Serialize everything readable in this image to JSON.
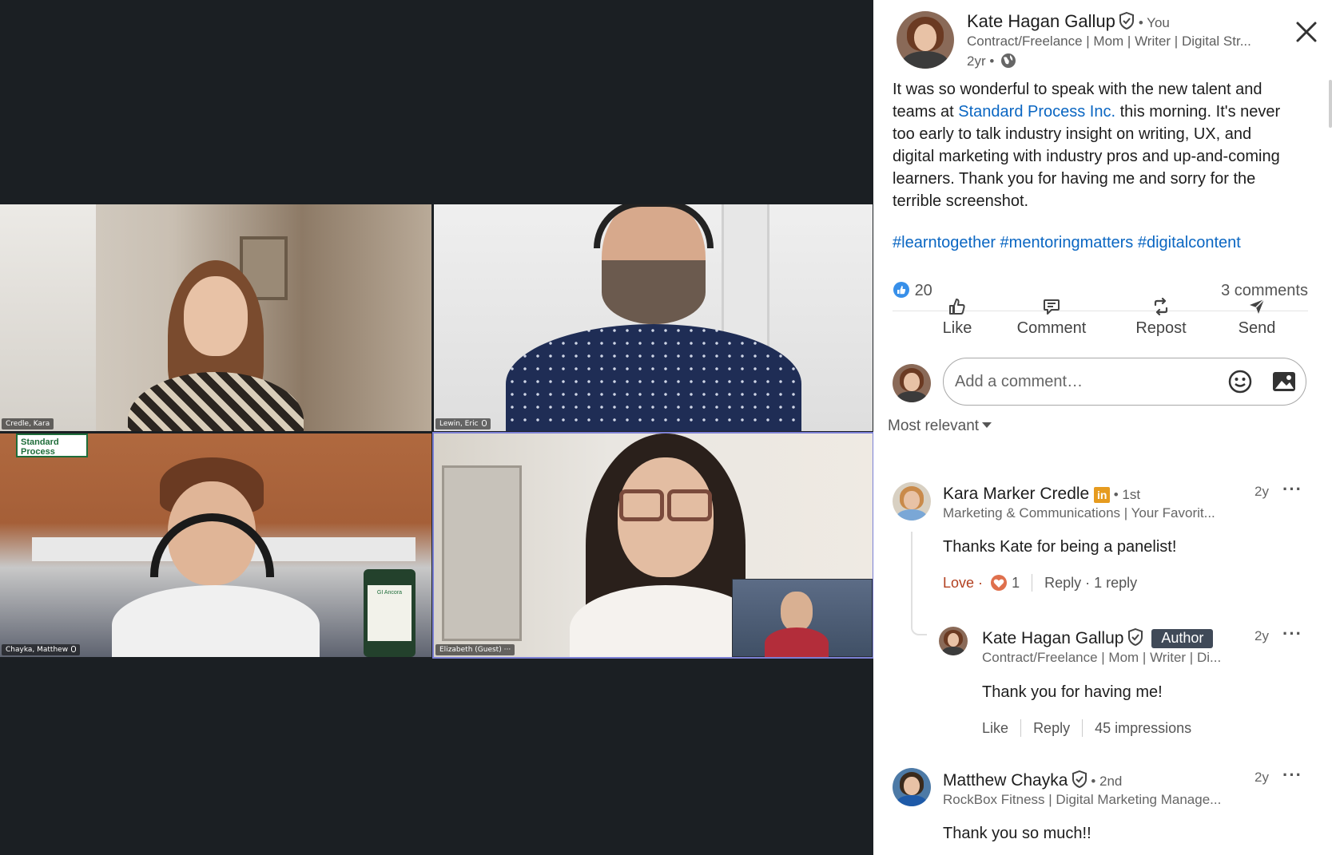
{
  "viewer": {
    "tiles": [
      {
        "name": "Credle, Kara"
      },
      {
        "name": "Lewin, Eric"
      },
      {
        "name": "Chayka, Matthew"
      },
      {
        "name": "Elizabeth (Guest)"
      }
    ],
    "sign_text": "Standard Process",
    "bottle_text": "GI Ancora"
  },
  "post": {
    "author": "Kate Hagan Gallup",
    "you_label": "• You",
    "headline": "Contract/Freelance | Mom | Writer | Digital Str...",
    "time": "2yr •",
    "text_before_link": "It was so wonderful to speak with the new talent and teams at ",
    "link_text": "Standard Process Inc.",
    "text_after_link": " this morning. It's never too early to talk industry insight on writing, UX, and digital marketing with industry pros and up-and-coming learners. Thank you for having me and sorry for the terrible screenshot.",
    "hashtags": "#learntogether #mentoringmatters #digitalcontent",
    "reactions_count": "20",
    "comments_count": "3 comments"
  },
  "actions": {
    "like": "Like",
    "comment": "Comment",
    "repost": "Repost",
    "send": "Send"
  },
  "comment_input": {
    "placeholder": "Add a comment…"
  },
  "sort": {
    "label": "Most relevant"
  },
  "comments": [
    {
      "name": "Kara Marker Credle",
      "degree": "• 1st",
      "headline": "Marketing & Communications | Your Favorit...",
      "time": "2y",
      "text": "Thanks Kate for being a panelist!",
      "reaction_label": "Love ·",
      "reaction_count": "1",
      "reply_label": "Reply",
      "replies": "· 1 reply"
    },
    {
      "name": "Kate Hagan Gallup",
      "badge": "Author",
      "headline": "Contract/Freelance | Mom | Writer | Di...",
      "time": "2y",
      "text": "Thank you for having me!",
      "like_label": "Like",
      "reply_label": "Reply",
      "impressions": "45 impressions"
    },
    {
      "name": "Matthew Chayka",
      "degree": "• 2nd",
      "headline": "RockBox Fitness | Digital Marketing Manage...",
      "time": "2y",
      "text": "Thank you so much!!"
    }
  ],
  "colors": {
    "link": "#0a66c2",
    "love": "#b24020",
    "viewer_bg": "#1b1f23",
    "author_badge": "#404a58"
  },
  "icons": [
    "close-icon",
    "verified-shield-icon",
    "globe-icon",
    "like-reaction-icon",
    "like-icon",
    "comment-icon",
    "repost-icon",
    "send-icon",
    "emoji-icon",
    "image-icon",
    "more-options-icon",
    "love-reaction-icon",
    "linkedin-premium-icon",
    "caret-down-icon"
  ]
}
